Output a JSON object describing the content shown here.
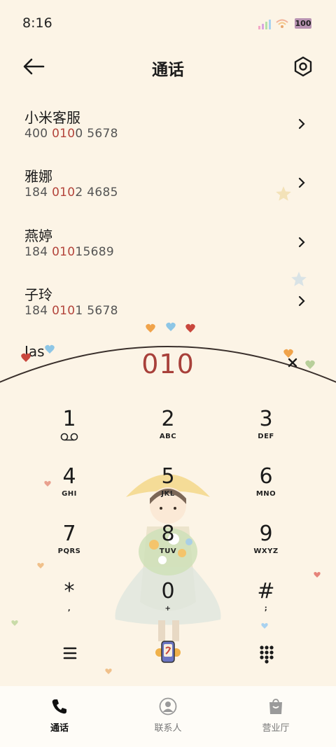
{
  "status_bar": {
    "time": "8:16",
    "battery": "100"
  },
  "header": {
    "title": "通话"
  },
  "contacts": [
    {
      "name": "小米客服",
      "number_pre": "400 ",
      "number_match": "010",
      "number_post": "0 5678"
    },
    {
      "name": "雅娜",
      "number_pre": "184 ",
      "number_match": "010",
      "number_post": "2 4685"
    },
    {
      "name": "燕婷",
      "number_pre": "184 ",
      "number_match": "010",
      "number_post": "15689"
    },
    {
      "name": "子玲",
      "number_pre": "184 ",
      "number_match": "010",
      "number_post": "1 5678"
    },
    {
      "name": "Jas",
      "number_pre": "",
      "number_match": "",
      "number_post": ""
    }
  ],
  "dialer": {
    "entered_number": "010",
    "keys": [
      {
        "digit": "1",
        "letters": ""
      },
      {
        "digit": "2",
        "letters": "ABC"
      },
      {
        "digit": "3",
        "letters": "DEF"
      },
      {
        "digit": "4",
        "letters": "GHI"
      },
      {
        "digit": "5",
        "letters": "JKL"
      },
      {
        "digit": "6",
        "letters": "MNO"
      },
      {
        "digit": "7",
        "letters": "PQRS"
      },
      {
        "digit": "8",
        "letters": "TUV"
      },
      {
        "digit": "9",
        "letters": "WXYZ"
      },
      {
        "digit": "*",
        "letters": ","
      },
      {
        "digit": "0",
        "letters": "+"
      },
      {
        "digit": "#",
        "letters": ";"
      }
    ]
  },
  "tabs": [
    {
      "label": "通话",
      "icon": "phone-icon",
      "active": true
    },
    {
      "label": "联系人",
      "icon": "contacts-icon",
      "active": false
    },
    {
      "label": "营业厅",
      "icon": "shop-bag-icon",
      "active": false
    }
  ],
  "colors": {
    "background": "#fcf4e6",
    "accent": "#a8403a"
  }
}
